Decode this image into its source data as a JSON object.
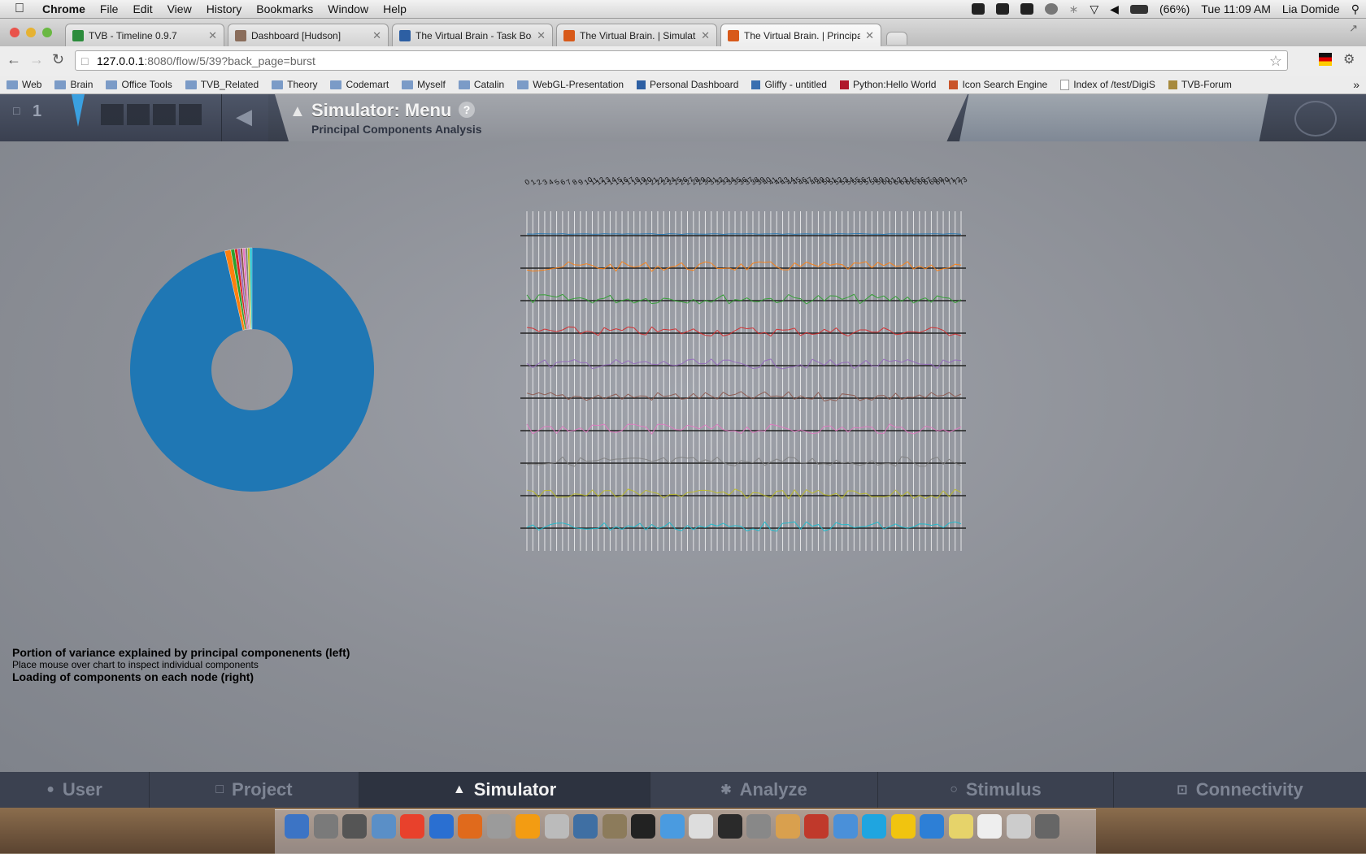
{
  "menubar": {
    "app": "Chrome",
    "items": [
      "File",
      "Edit",
      "View",
      "History",
      "Bookmarks",
      "Window",
      "Help"
    ],
    "battery": "(66%)",
    "clock": "Tue 11:09 AM",
    "user": "Lia Domide"
  },
  "tabs": [
    {
      "title": "TVB - Timeline 0.9.7",
      "color": "#2c8c3c"
    },
    {
      "title": "Dashboard [Hudson]",
      "color": "#8a6d5b"
    },
    {
      "title": "The Virtual Brain - Task Boar",
      "color": "#2d5fa3"
    },
    {
      "title": "The Virtual Brain. | Simulatio",
      "color": "#d85a1a"
    },
    {
      "title": "The Virtual Brain. | Principal",
      "color": "#d85a1a"
    }
  ],
  "address": {
    "host": "127.0.0.1",
    "path": ":8080/flow/5/39?back_page=burst"
  },
  "bookmarks": [
    {
      "label": "Web",
      "folder": true
    },
    {
      "label": "Brain",
      "folder": true
    },
    {
      "label": "Office Tools",
      "folder": true
    },
    {
      "label": "TVB_Related",
      "folder": true
    },
    {
      "label": "Theory",
      "folder": true
    },
    {
      "label": "Codemart",
      "folder": true
    },
    {
      "label": "Myself",
      "folder": true
    },
    {
      "label": "Catalin",
      "folder": true
    },
    {
      "label": "WebGL-Presentation",
      "folder": true
    },
    {
      "label": "Personal Dashboard",
      "folder": false
    },
    {
      "label": "Gliffy - untitled",
      "folder": false
    },
    {
      "label": "Python:Hello World",
      "folder": false
    },
    {
      "label": "Icon Search Engine",
      "folder": false
    },
    {
      "label": "Index of /test/DigiS",
      "folder": false
    },
    {
      "label": "TVB-Forum",
      "folder": false
    }
  ],
  "header": {
    "project_count": "1",
    "title": "Simulator: Menu",
    "subtitle": "Principal Components Analysis",
    "help": "?"
  },
  "legend": {
    "line1": "Portion of variance explained by principal componenents (left)",
    "line2": "Place mouse over chart to inspect individual components",
    "line3": "Loading of components on each node (right)"
  },
  "bottom_nav": [
    "User",
    "Project",
    "Simulator",
    "Analyze",
    "Stimulus",
    "Connectivity"
  ],
  "active_nav": "Simulator",
  "colors": {
    "pie_main": "#1f77b4",
    "series": [
      "#1f77b4",
      "#ff7f0e",
      "#2ca02c",
      "#d62728",
      "#9467bd",
      "#8c564b",
      "#e377c2",
      "#7f7f7f",
      "#bcbd22",
      "#17becf"
    ]
  },
  "chart_data": [
    {
      "type": "pie",
      "donut": true,
      "values": [
        96.4,
        0.8,
        0.5,
        0.4,
        0.35,
        0.3,
        0.35,
        0.3,
        0.3,
        0.3
      ]
    },
    {
      "type": "line",
      "series_count": 10,
      "node_count": 74
    }
  ]
}
